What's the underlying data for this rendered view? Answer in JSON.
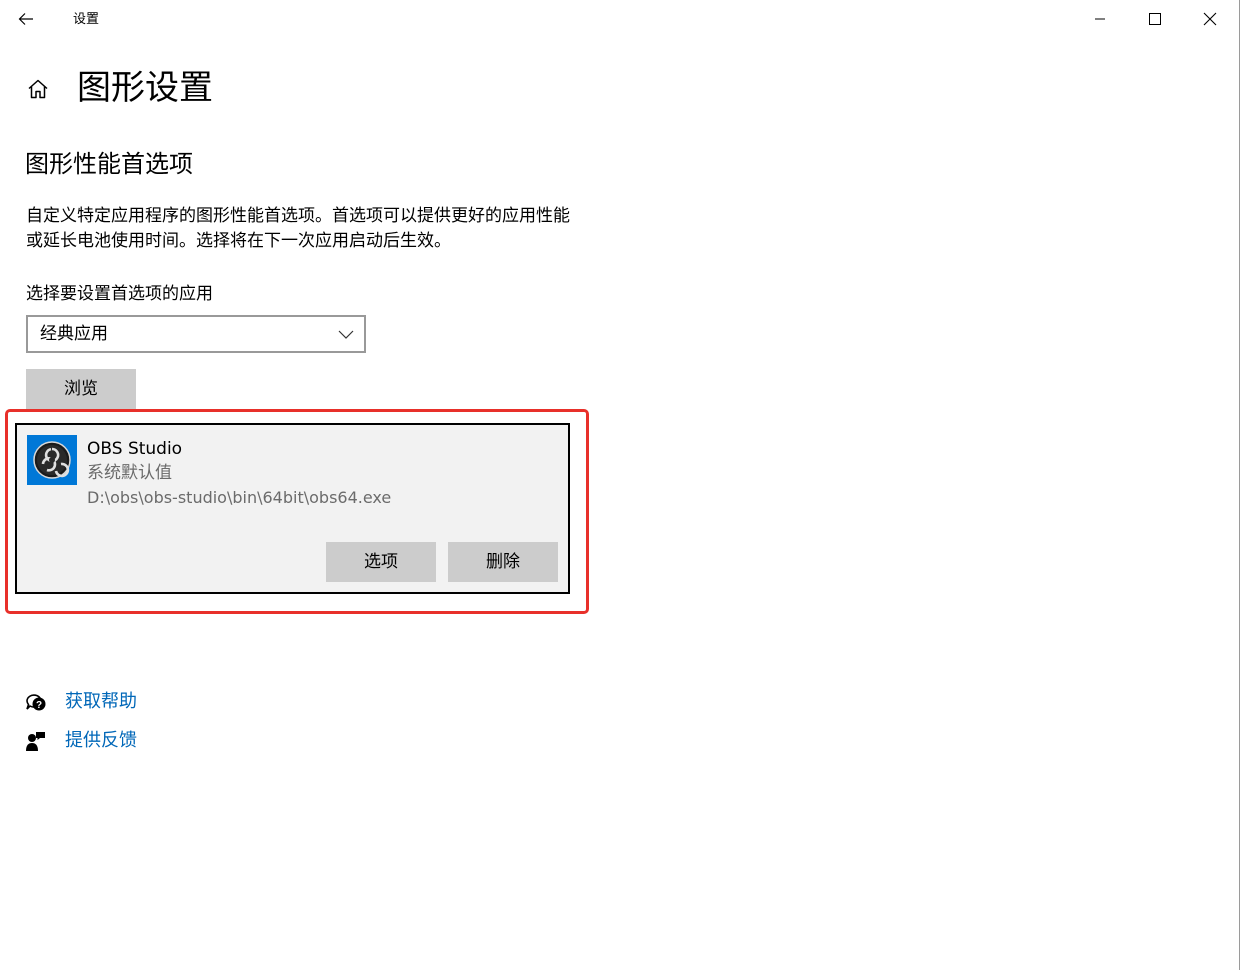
{
  "titlebar": {
    "title": "设置",
    "back_icon": "arrow-left-icon",
    "minimize_icon": "minimize-icon",
    "maximize_icon": "maximize-icon",
    "close_icon": "close-icon"
  },
  "header": {
    "home_icon": "home-icon",
    "page_title": "图形设置"
  },
  "section": {
    "title": "图形性能首选项",
    "description": "自定义特定应用程序的图形性能首选项。首选项可以提供更好的应用性能或延长电池使用时间。选择将在下一次应用启动后生效。",
    "select_label": "选择要设置首选项的应用",
    "dropdown_value": "经典应用",
    "browse_label": "浏览"
  },
  "app_card": {
    "icon": "obs-studio-icon",
    "name": "OBS Studio",
    "preference": "系统默认值",
    "path": "D:\\obs\\obs-studio\\bin\\64bit\\obs64.exe",
    "options_label": "选项",
    "delete_label": "删除"
  },
  "links": {
    "help_icon": "help-chat-icon",
    "help_label": "获取帮助",
    "feedback_icon": "feedback-icon",
    "feedback_label": "提供反馈"
  },
  "colors": {
    "link": "#0067b8",
    "highlight": "#e8302a",
    "app_icon_bg": "#0078d7",
    "button_bg": "#cccccc",
    "card_bg": "#f2f2f2"
  }
}
